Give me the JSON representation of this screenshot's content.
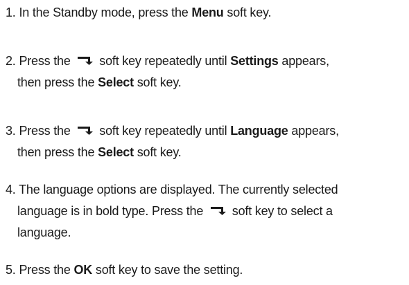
{
  "steps": [
    {
      "number": "1.",
      "lines": [
        [
          {
            "t": "In the Standby mode, press the "
          },
          {
            "b": "Menu"
          },
          {
            "t": " soft key."
          }
        ]
      ]
    },
    {
      "number": "2.",
      "lines": [
        [
          {
            "t": "Press the "
          },
          {
            "icon": "down-arrow-softkey-icon"
          },
          {
            "t": " soft key repeatedly until "
          },
          {
            "b": "Settings"
          },
          {
            "t": " appears,"
          }
        ],
        [
          {
            "t": "then press the "
          },
          {
            "b": "Select"
          },
          {
            "t": " soft key."
          }
        ]
      ]
    },
    {
      "number": "3.",
      "lines": [
        [
          {
            "t": "Press the "
          },
          {
            "icon": "down-arrow-softkey-icon"
          },
          {
            "t": " soft key repeatedly until "
          },
          {
            "b": "Language"
          },
          {
            "t": " appears,"
          }
        ],
        [
          {
            "t": "then press the "
          },
          {
            "b": "Select"
          },
          {
            "t": " soft key."
          }
        ]
      ]
    },
    {
      "number": "4.",
      "lines": [
        [
          {
            "t": "The language options are displayed. The currently selected"
          }
        ],
        [
          {
            "t": "language is in bold type. Press the "
          },
          {
            "icon": "down-arrow-softkey-icon"
          },
          {
            "t": " soft key to select a"
          }
        ],
        [
          {
            "t": "language."
          }
        ]
      ]
    },
    {
      "number": "5.",
      "lines": [
        [
          {
            "t": "Press the "
          },
          {
            "b": "OK"
          },
          {
            "t": " soft key to save the setting."
          }
        ]
      ]
    }
  ]
}
